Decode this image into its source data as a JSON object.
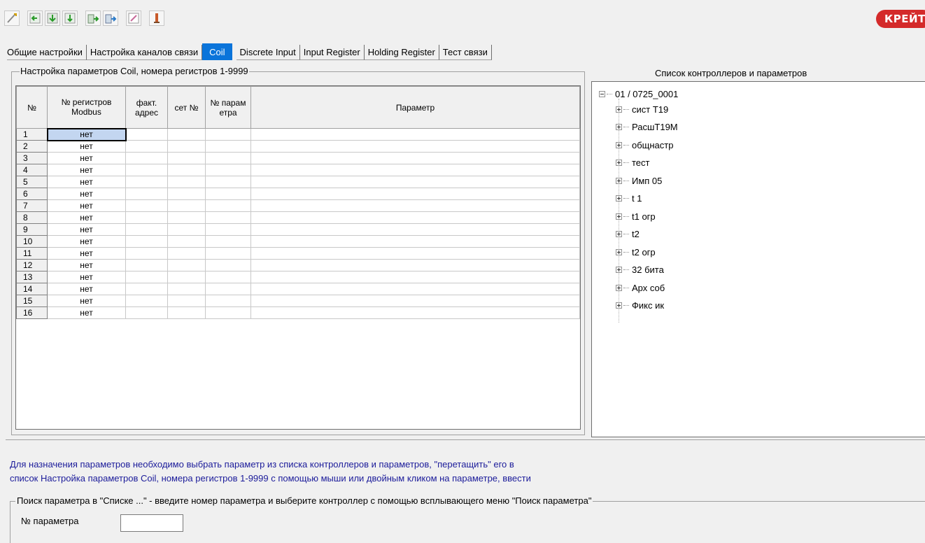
{
  "toolbar": {
    "buttons": [
      "edit-icon",
      "arrow-left-icon",
      "arrow-add-icon",
      "arrow-down-icon",
      "import-icon",
      "export-icon",
      "pencil-icon",
      "info-icon"
    ]
  },
  "logo": {
    "text": "КРЕЙТ"
  },
  "tabs": [
    {
      "label": "Общие настройки",
      "active": false
    },
    {
      "label": "Настройка каналов связи",
      "active": false
    },
    {
      "label": "Coil",
      "active": true
    },
    {
      "label": "Discrete Input",
      "active": false
    },
    {
      "label": "Input Register",
      "active": false
    },
    {
      "label": "Holding Register",
      "active": false
    },
    {
      "label": "Тест связи",
      "active": false
    }
  ],
  "left_panel": {
    "title": "Настройка параметров Coil, номера регистров 1-9999",
    "columns": {
      "num": "№",
      "modbus": "№ регистров Modbus",
      "fact": "факт. адрес",
      "net": "сет №",
      "param_no": "№ парам етра",
      "param": "Параметр"
    },
    "rows": [
      {
        "num": "1",
        "modbus": "нет",
        "fact": "",
        "net": "",
        "param_no": "",
        "param": ""
      },
      {
        "num": "2",
        "modbus": "нет",
        "fact": "",
        "net": "",
        "param_no": "",
        "param": ""
      },
      {
        "num": "3",
        "modbus": "нет",
        "fact": "",
        "net": "",
        "param_no": "",
        "param": ""
      },
      {
        "num": "4",
        "modbus": "нет",
        "fact": "",
        "net": "",
        "param_no": "",
        "param": ""
      },
      {
        "num": "5",
        "modbus": "нет",
        "fact": "",
        "net": "",
        "param_no": "",
        "param": ""
      },
      {
        "num": "6",
        "modbus": "нет",
        "fact": "",
        "net": "",
        "param_no": "",
        "param": ""
      },
      {
        "num": "7",
        "modbus": "нет",
        "fact": "",
        "net": "",
        "param_no": "",
        "param": ""
      },
      {
        "num": "8",
        "modbus": "нет",
        "fact": "",
        "net": "",
        "param_no": "",
        "param": ""
      },
      {
        "num": "9",
        "modbus": "нет",
        "fact": "",
        "net": "",
        "param_no": "",
        "param": ""
      },
      {
        "num": "10",
        "modbus": "нет",
        "fact": "",
        "net": "",
        "param_no": "",
        "param": ""
      },
      {
        "num": "11",
        "modbus": "нет",
        "fact": "",
        "net": "",
        "param_no": "",
        "param": ""
      },
      {
        "num": "12",
        "modbus": "нет",
        "fact": "",
        "net": "",
        "param_no": "",
        "param": ""
      },
      {
        "num": "13",
        "modbus": "нет",
        "fact": "",
        "net": "",
        "param_no": "",
        "param": ""
      },
      {
        "num": "14",
        "modbus": "нет",
        "fact": "",
        "net": "",
        "param_no": "",
        "param": ""
      },
      {
        "num": "15",
        "modbus": "нет",
        "fact": "",
        "net": "",
        "param_no": "",
        "param": ""
      },
      {
        "num": "16",
        "modbus": "нет",
        "fact": "",
        "net": "",
        "param_no": "",
        "param": ""
      }
    ]
  },
  "tree": {
    "title": "Список контроллеров и параметров",
    "root": "01 / 0725_0001",
    "items": [
      "сист Т19",
      "РасшТ19М",
      "общнастр",
      "тест",
      "Имп 05",
      "t 1",
      "t1 огр",
      "t2",
      "t2 огр",
      "32 бита",
      "Арх соб",
      "Фикс ик"
    ]
  },
  "info": {
    "line1": "Для назначения параметров необходимо  выбрать параметр из списка контроллеров и параметров, \"перетащить\" его в",
    "line2": "список Настройка параметров Coil, номера регистров 1-9999 с помощью мыши или двойным кликом на параметре, ввести"
  },
  "search": {
    "title": "Поиск параметра в \"Списке ...\" - введите номер параметра и выберите контроллер с помощью всплывающего меню \"Поиск параметра\"",
    "label": "№ параметра",
    "value": ""
  },
  "colors": {
    "accent": "#0a74da",
    "info_text": "#1b1b9a",
    "logo": "#d42a2a"
  }
}
